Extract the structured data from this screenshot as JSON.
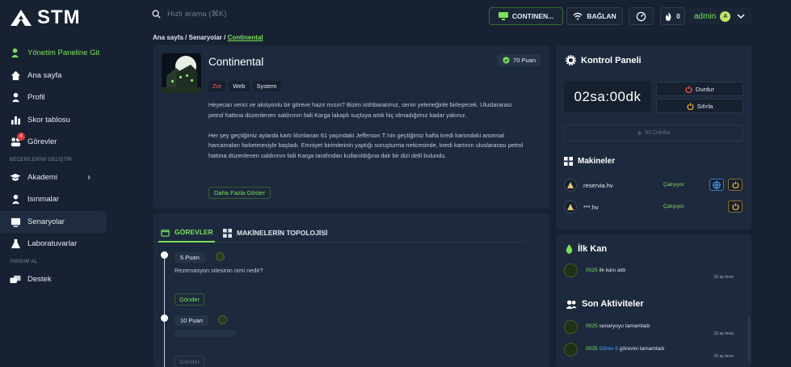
{
  "brand": {
    "name": "STM"
  },
  "sidebar": {
    "items": [
      {
        "label": "Yönetim Paneline Git",
        "icon": "user-check-icon",
        "green": true
      },
      {
        "label": "Ana sayfa",
        "icon": "home-icon"
      },
      {
        "label": "Profil",
        "icon": "user-icon"
      },
      {
        "label": "Skor tablosu",
        "icon": "bar-chart-icon"
      },
      {
        "label": "Görevler",
        "icon": "users-icon",
        "badge": "4"
      }
    ],
    "section1": "BECERİLERİNİ GELİŞTİR",
    "items2": [
      {
        "label": "Akademi",
        "icon": "graduation-cap-icon"
      },
      {
        "label": "Isınmalar",
        "icon": "user-icon"
      },
      {
        "label": "Senaryolar",
        "icon": "scenario-icon",
        "active": true
      },
      {
        "label": "Laboratuvarlar",
        "icon": "flask-icon"
      }
    ],
    "section2": "YARDIM AL",
    "items3": [
      {
        "label": "Destek",
        "icon": "support-icon"
      }
    ]
  },
  "topbar": {
    "search_placeholder": "Hızlı arama (⌘K)",
    "continent_btn": "CONTINEN...",
    "connect_btn": "BAĞLAN",
    "fire_count": "0",
    "user": "admin",
    "avatar": "A"
  },
  "breadcrumb": {
    "home": "Ana sayfa",
    "sep": "/",
    "parent": "Senaryolar",
    "current": "Continental"
  },
  "scenario": {
    "title": "Continental",
    "points": "70 Puan",
    "tags": [
      "Zor",
      "Web",
      "System"
    ],
    "desc1": "Heyecan verici ve aksiyonlu bir göreve hazır mısın? Bizim istihbaratımız, senin yeteneğinle birleşecek. Uluslararası petrol hattına düzenlenen saldırının faili Karga lakaplı suçluya artık hiç olmadığımız kadar yakınız.",
    "desc2": "Her şey geçtiğimiz aylarda kartı klonlanan 61 yaşındaki Jefferson T.'nin geçtiğimiz hafta kredi kartındaki anormal harcamaları farketmesiyle başladı. Emniyet birimlerinin yaptığı soruşturma neticesinde, kredi kartının uluslararası petrol hattına düzenlenen saldırının faili Karga tarafından kullanıldığına dair bir dizi delil bulundu.",
    "more_btn": "Daha Fazla Göster"
  },
  "tasks_panel": {
    "tab_tasks": "GÖREVLER",
    "tab_topology": "MAKİNELERİN TOPOLOJİSİ",
    "task1": {
      "points": "5 Puan",
      "question": "Rezervasyon sitesinin ismi nedir?",
      "submit": "Gönder"
    },
    "task2": {
      "points": "10 Puan",
      "submit": "Gönder"
    }
  },
  "control": {
    "title": "Kontrol Paneli",
    "timer": "02sa:00dk",
    "stop": "Durdur",
    "reset": "Sıfırla",
    "extend": "60 Dakika"
  },
  "machines": {
    "title": "Makineler",
    "list": [
      {
        "name": "reservia.hv",
        "status": "Çalışıyor"
      },
      {
        "name": "***.hv",
        "status": "Çalışıyor"
      }
    ]
  },
  "first_blood": {
    "title": "İlk Kan",
    "user": "0025",
    "text": "ilk kanı aldı",
    "time": "10 ay önce"
  },
  "activities": {
    "title": "Son Aktiviteler",
    "list": [
      {
        "user": "0025",
        "pre": "",
        "mid": "",
        "text": "senaryoyu tamamladı",
        "time": "10 ay önce"
      },
      {
        "user": "0025",
        "pre": "Görev",
        "mid": "5",
        "text": "görevini tamamladı",
        "time": "10 ay önce"
      }
    ]
  },
  "colors": {
    "accent": "#7be05a",
    "danger": "#ff5555",
    "link": "#4aa3ff",
    "bg": "#172132",
    "card": "#1d2a3d"
  }
}
